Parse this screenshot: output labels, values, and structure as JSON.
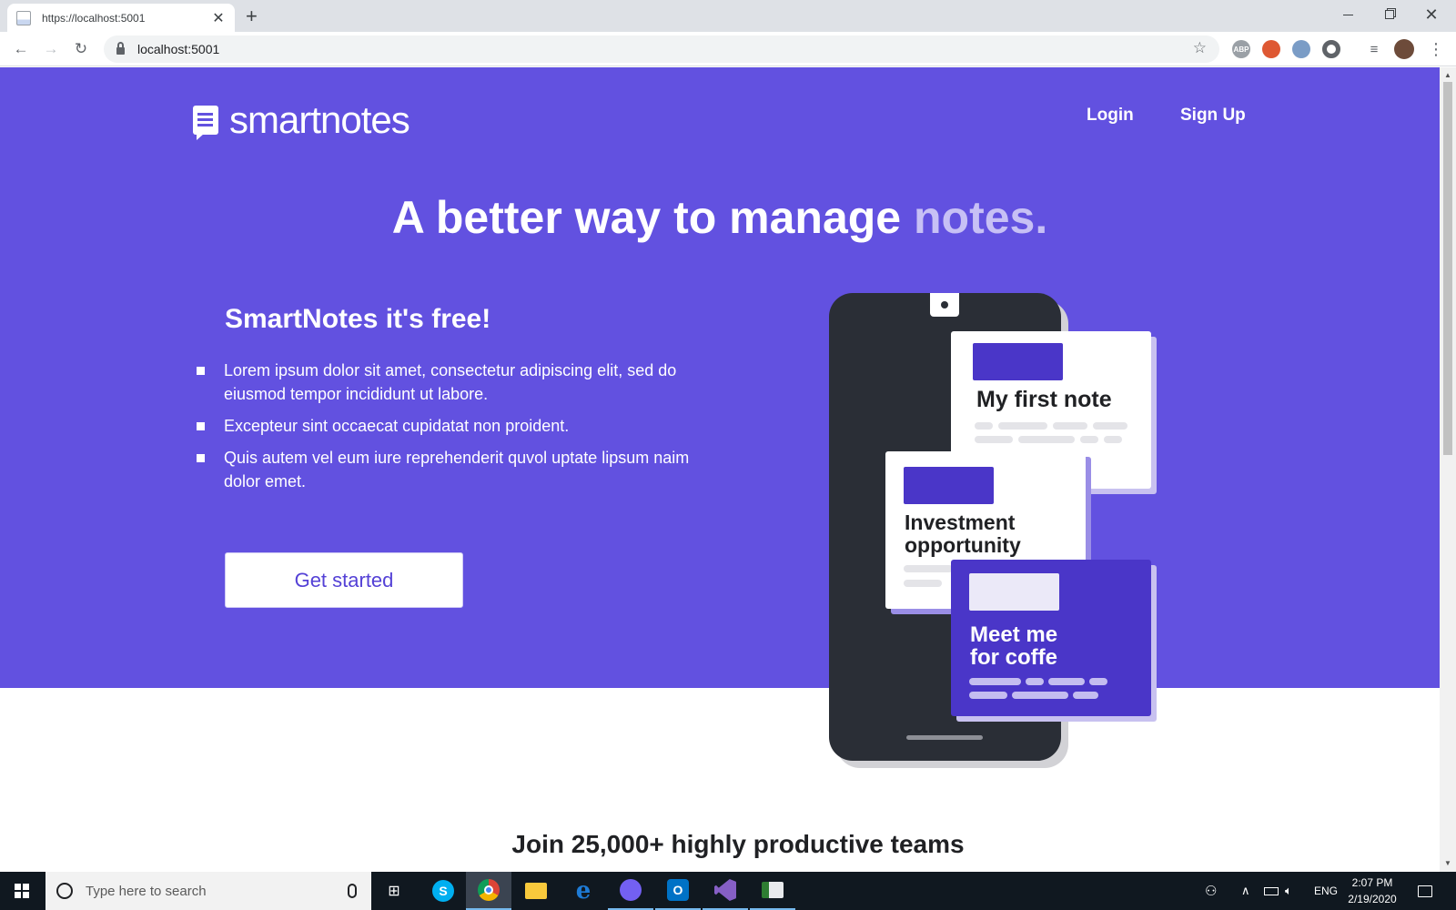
{
  "browser": {
    "tab_title": "https://localhost:5001",
    "tab_close": "✕",
    "new_tab": "+",
    "address": "localhost:5001",
    "extensions": [
      {
        "name": "adblock-icon",
        "label": "ABP",
        "color": "#9aa0a6"
      },
      {
        "name": "duckduckgo-icon",
        "label": "",
        "color": "#de5833"
      },
      {
        "name": "feather-extension-icon",
        "label": "",
        "color": "#7a9cc6"
      },
      {
        "name": "circle-extension-icon",
        "label": "",
        "color": "#5f6368"
      }
    ]
  },
  "site": {
    "logo_text": "smartnotes",
    "nav": {
      "login": "Login",
      "signup": "Sign Up"
    },
    "headline_main": "A better way to manage ",
    "headline_accent": "notes.",
    "subhead": "SmartNotes it's free!",
    "features": [
      "Lorem ipsum dolor sit amet, consectetur adipiscing elit, sed do eiusmod tempor incididunt ut labore.",
      "Excepteur sint occaecat cupidatat non proident.",
      "Quis autem vel eum iure reprehenderit quvol uptate lipsum naim dolor emet."
    ],
    "cta": "Get started",
    "cards": [
      {
        "title": "My first note"
      },
      {
        "title_line1": "Investment",
        "title_line2": "opportunity"
      },
      {
        "title_line1": "Meet me",
        "title_line2": "for coffe"
      }
    ],
    "join_text": "Join 25,000+ highly productive teams"
  },
  "colors": {
    "hero_bg": "#6251e0",
    "accent_text": "#c7c0f5",
    "card_tag": "#4a36c8",
    "phone": "#2a2e36"
  },
  "taskbar": {
    "search_placeholder": "Type here to search",
    "apps": [
      {
        "name": "task-view-icon",
        "label": "⊞"
      },
      {
        "name": "skype-icon",
        "label": "S"
      },
      {
        "name": "chrome-icon",
        "label": ""
      },
      {
        "name": "file-explorer-icon",
        "label": ""
      },
      {
        "name": "edge-icon",
        "label": "e"
      },
      {
        "name": "viber-icon",
        "label": ""
      },
      {
        "name": "outlook-icon",
        "label": "O"
      },
      {
        "name": "visual-studio-icon",
        "label": ""
      },
      {
        "name": "app-icon",
        "label": ""
      }
    ],
    "language": "ENG",
    "time": "2:07 PM",
    "date": "2/19/2020"
  }
}
